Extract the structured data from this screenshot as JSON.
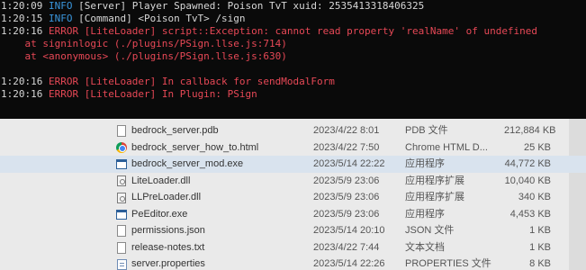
{
  "console": {
    "lines": [
      {
        "time": "1:20:09",
        "level": "INFO",
        "msg": "[Server] Player Spawned: Poison TvT xuid: 2535413318406325"
      },
      {
        "time": "1:20:15",
        "level": "INFO",
        "msg": "[Command] <Poison TvT> /sign"
      },
      {
        "time": "1:20:16",
        "level": "ERROR",
        "msg": "[LiteLoader] script::Exception: cannot read property 'realName' of undefined"
      },
      {
        "time": "",
        "level": "",
        "msg": "    at signinlogic (./plugins/PSign.llse.js:714)"
      },
      {
        "time": "",
        "level": "",
        "msg": "    at <anonymous> (./plugins/PSign.llse.js:630)"
      },
      {
        "time": "",
        "level": "",
        "msg": ""
      },
      {
        "time": "1:20:16",
        "level": "ERROR",
        "msg": "[LiteLoader] In callback for sendModalForm"
      },
      {
        "time": "1:20:16",
        "level": "ERROR",
        "msg": "[LiteLoader] In Plugin: PSign"
      }
    ]
  },
  "files": [
    {
      "name": "bedrock_server.pdb",
      "date": "2023/4/22 8:01",
      "type": "PDB 文件",
      "size": "212,884 KB",
      "icon": "file-icon"
    },
    {
      "name": "bedrock_server_how_to.html",
      "date": "2023/4/22 7:50",
      "type": "Chrome HTML D...",
      "size": "25 KB",
      "icon": "chrome-icon"
    },
    {
      "name": "bedrock_server_mod.exe",
      "date": "2023/5/14 22:22",
      "type": "应用程序",
      "size": "44,772 KB",
      "icon": "exe-icon",
      "selected": true
    },
    {
      "name": "LiteLoader.dll",
      "date": "2023/5/9 23:06",
      "type": "应用程序扩展",
      "size": "10,040 KB",
      "icon": "dll-icon"
    },
    {
      "name": "LLPreLoader.dll",
      "date": "2023/5/9 23:06",
      "type": "应用程序扩展",
      "size": "340 KB",
      "icon": "dll-icon"
    },
    {
      "name": "PeEditor.exe",
      "date": "2023/5/9 23:06",
      "type": "应用程序",
      "size": "4,453 KB",
      "icon": "exe-icon"
    },
    {
      "name": "permissions.json",
      "date": "2023/5/14 20:10",
      "type": "JSON 文件",
      "size": "1 KB",
      "icon": "file-icon"
    },
    {
      "name": "release-notes.txt",
      "date": "2023/4/22 7:44",
      "type": "文本文档",
      "size": "1 KB",
      "icon": "file-icon"
    },
    {
      "name": "server.properties",
      "date": "2023/5/14 22:26",
      "type": "PROPERTIES 文件",
      "size": "8 KB",
      "icon": "props-icon"
    }
  ]
}
